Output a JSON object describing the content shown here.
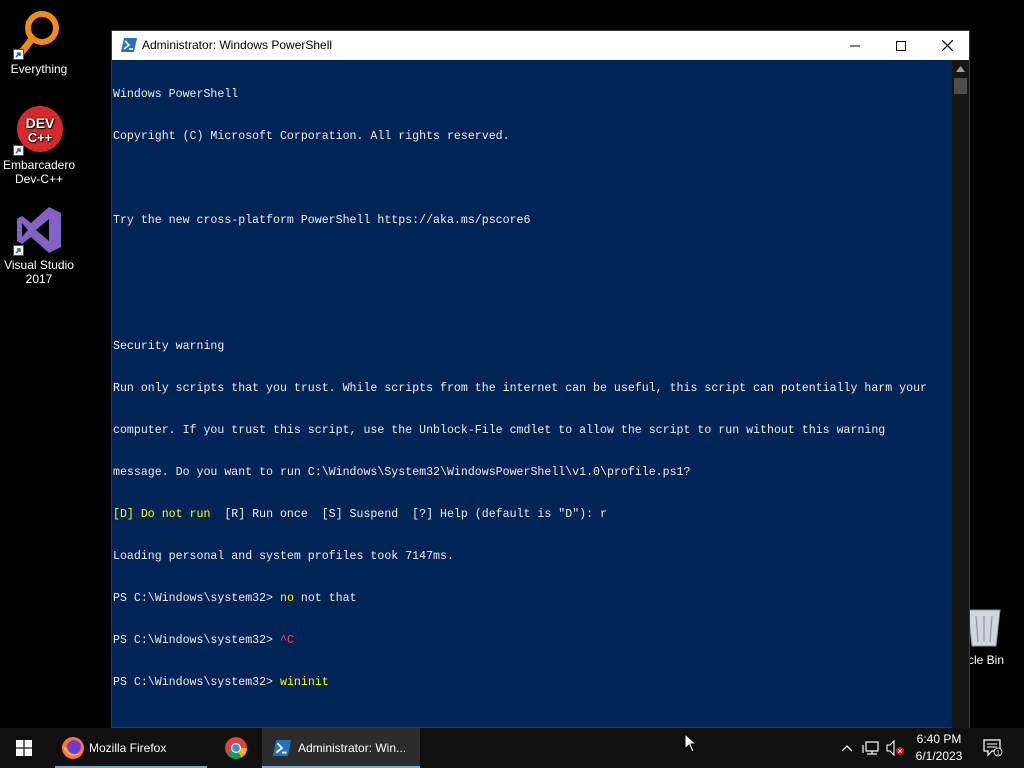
{
  "desktop": {
    "icons": [
      {
        "label": "Everything"
      },
      {
        "label": "Embarcadero Dev-C++"
      },
      {
        "label": "Visual Studio 2017"
      }
    ],
    "recycle_bin_partial_label": "cle Bin"
  },
  "window": {
    "title": "Administrator: Windows PowerShell",
    "console_lines": [
      "Windows PowerShell",
      "Copyright (C) Microsoft Corporation. All rights reserved.",
      "",
      "Try the new cross-platform PowerShell https://aka.ms/pscore6",
      "",
      "",
      "Security warning",
      "Run only scripts that you trust. While scripts from the internet can be useful, this script can potentially harm your",
      "computer. If you trust this script, use the Unblock-File cmdlet to allow the script to run without this warning",
      "message. Do you want to run C:\\Windows\\System32\\WindowsPowerShell\\v1.0\\profile.ps1?"
    ],
    "prompt_choice": {
      "default_option": "[D] Do not run",
      "rest": "  [R] Run once  [S] Suspend  [?] Help (default is \"D\"): r"
    },
    "loading_line": "Loading personal and system profiles took 7147ms.",
    "prompt": "PS C:\\Windows\\system32> ",
    "commands": [
      {
        "text": "no",
        "rest": " not that",
        "class": "yellow"
      },
      {
        "text": "^C",
        "rest": "",
        "class": "red"
      },
      {
        "text": "wininit",
        "rest": "",
        "class": "yellow"
      }
    ]
  },
  "taskbar": {
    "apps": [
      {
        "label": "Mozilla Firefox"
      },
      {
        "label": ""
      },
      {
        "label": "Administrator: Win..."
      }
    ],
    "clock": {
      "time": "6:40 PM",
      "date": "6/1/2023"
    },
    "notification_count": "1"
  }
}
